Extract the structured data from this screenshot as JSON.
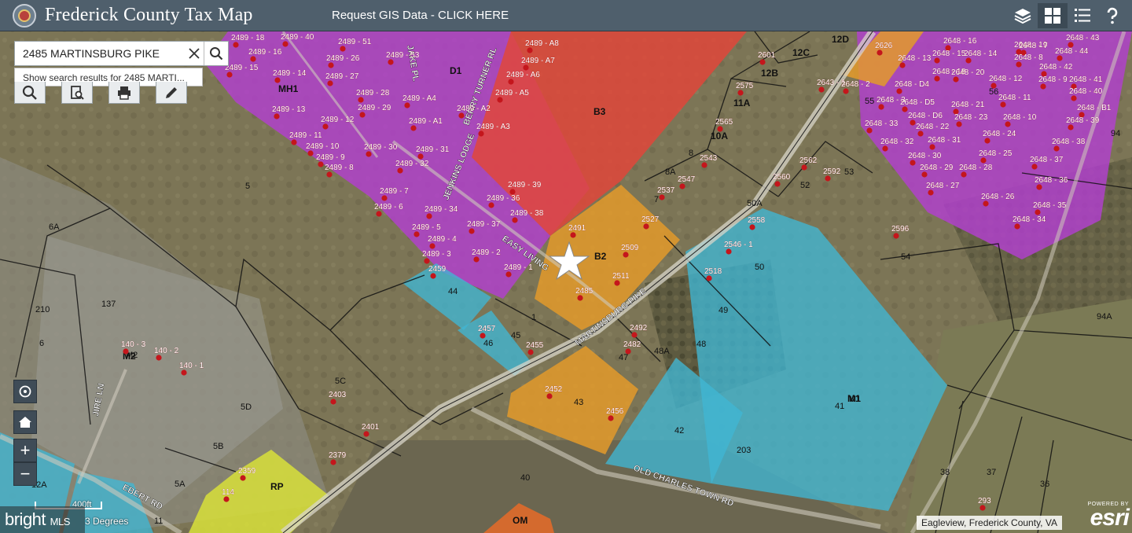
{
  "header": {
    "title": "Frederick County Tax Map",
    "gis_link": "Request GIS Data - CLICK HERE"
  },
  "search": {
    "value": "2485 MARTINSBURG PIKE",
    "suggestion": "Show search results for 2485 MARTI..."
  },
  "zoom": {
    "in": "+",
    "out": "−"
  },
  "scale": {
    "label": "400ft",
    "degrees": "3 Degrees"
  },
  "attribution": "Eagleview, Frederick County, VA",
  "powered_by": "POWERED BY",
  "esri": "esri",
  "watermark": {
    "main": "bright",
    "sub": "MLS"
  },
  "colors": {
    "mh1_purple": "#b23fcf",
    "b3_red": "#e0463a",
    "b2_orange": "#e39a2a",
    "m1_blue": "#40b6d4",
    "rp_yellow": "#d8e03a",
    "om_orange": "#e06a2a"
  },
  "zones": [
    {
      "name": "zone-mh1",
      "label": "MH1"
    },
    {
      "name": "zone-b3",
      "label": "B3"
    },
    {
      "name": "zone-b2",
      "label": "B2"
    },
    {
      "name": "zone-m2",
      "label": "M2"
    },
    {
      "name": "zone-m1",
      "label": "M1"
    },
    {
      "name": "zone-rp",
      "label": "RP"
    },
    {
      "name": "zone-om",
      "label": "OM"
    },
    {
      "name": "zone-12d",
      "label": "12D"
    },
    {
      "name": "zone-12c",
      "label": "12C"
    },
    {
      "name": "zone-12b",
      "label": "12B"
    },
    {
      "name": "zone-11a",
      "label": "11A"
    },
    {
      "name": "zone-10a",
      "label": "10A"
    },
    {
      "name": "zone-d1",
      "label": "D1"
    }
  ],
  "roads": [
    {
      "name": "road-martinsburg-pike",
      "label": "MARTINSBURG PIKE"
    },
    {
      "name": "road-easy-living",
      "label": "EASY LIVING"
    },
    {
      "name": "road-old-charles-town",
      "label": "OLD CHARLES TOWN RD"
    },
    {
      "name": "road-jire-ln",
      "label": "JIRE LN"
    },
    {
      "name": "road-ebert-rd",
      "label": "EBERT RD"
    },
    {
      "name": "road-jenkins-lodge",
      "label": "JENKINS LODGE"
    },
    {
      "name": "road-berry-turner",
      "label": "BERRY TURNER RL"
    },
    {
      "name": "road-jake-pl",
      "label": "JAKE PL"
    }
  ],
  "lots": [
    "5",
    "6A",
    "6",
    "M2",
    "M1",
    "41",
    "42",
    "43",
    "44",
    "45",
    "46",
    "47",
    "48",
    "48A",
    "49",
    "50",
    "50A",
    "52",
    "53",
    "54",
    "55",
    "56",
    "5C",
    "5D",
    "5B",
    "5A",
    "8",
    "8A",
    "7",
    "1",
    "11",
    "12A",
    "36",
    "37",
    "38",
    "40",
    "94",
    "94A",
    "203",
    "210",
    "137"
  ],
  "addresses": [
    "2489 - 18",
    "2489 - 40",
    "2489 - 51",
    "2489 - 16",
    "2489 - 26",
    "2489 - 53",
    "2489 - 15",
    "2489 - 14",
    "2489 - 27",
    "2489 - 28",
    "2489 - 13",
    "2489 - 12",
    "2489 - 29",
    "2489 - A4",
    "2489 - A1",
    "2489 - A2",
    "2489 - A3",
    "2489 - A5",
    "2489 - A6",
    "2489 - A7",
    "2489 - A8",
    "2489 - 11",
    "2489 - 10",
    "2489 - 30",
    "2489 - 31",
    "2489 - 9",
    "2489 - 32",
    "2489 - 8",
    "2489 - 7",
    "2489 - 39",
    "2489 - 6",
    "2489 - 34",
    "2489 - 36",
    "2489 - 38",
    "2489 - 5",
    "2489 - 37",
    "2489 - 4",
    "2489 - 3",
    "2489 - 2",
    "2489 - 1",
    "2491",
    "2509",
    "2511",
    "2485",
    "2527",
    "2537",
    "2547",
    "2543",
    "2459",
    "2457",
    "2455",
    "2452",
    "2456",
    "2492",
    "2482",
    "2518",
    "2546 - 1",
    "2558",
    "2560",
    "2562",
    "2592",
    "2575",
    "2565",
    "2601",
    "2626",
    "2596",
    "2401",
    "2403",
    "2379",
    "2359",
    "140 - 3",
    "140 - 2",
    "140 - 1",
    "114",
    "293",
    "2643 - 1",
    "2648 - 16",
    "2648 - 43",
    "2648 - 15",
    "2648 - 14",
    "2648 - 19",
    "2648 - 7",
    "2648 - 44",
    "2648 - 13",
    "2648 - 18",
    "2648 - 8",
    "2648 - 42",
    "2648 - 2",
    "2648 - D4",
    "2648 - 20",
    "2648 - 12",
    "2648 - 9",
    "2648 - 41",
    "2648 - 3",
    "2648 - D5",
    "2648 - 21",
    "2648 - 11",
    "2648 - 40",
    "2648 - D6",
    "2648 - 23",
    "2648 - 10",
    "2648 - B1",
    "2648 - 33",
    "2648 - 22",
    "2648 - 39",
    "2648 - 32",
    "2648 - 31",
    "2648 - 24",
    "2648 - 38",
    "2648 - 30",
    "2648 - 25",
    "2648 - 37",
    "2648 - 29",
    "2648 - 28",
    "2648 - 36",
    "2648 - 27",
    "2648 - 26",
    "2648 - 35",
    "2648 - 34"
  ]
}
